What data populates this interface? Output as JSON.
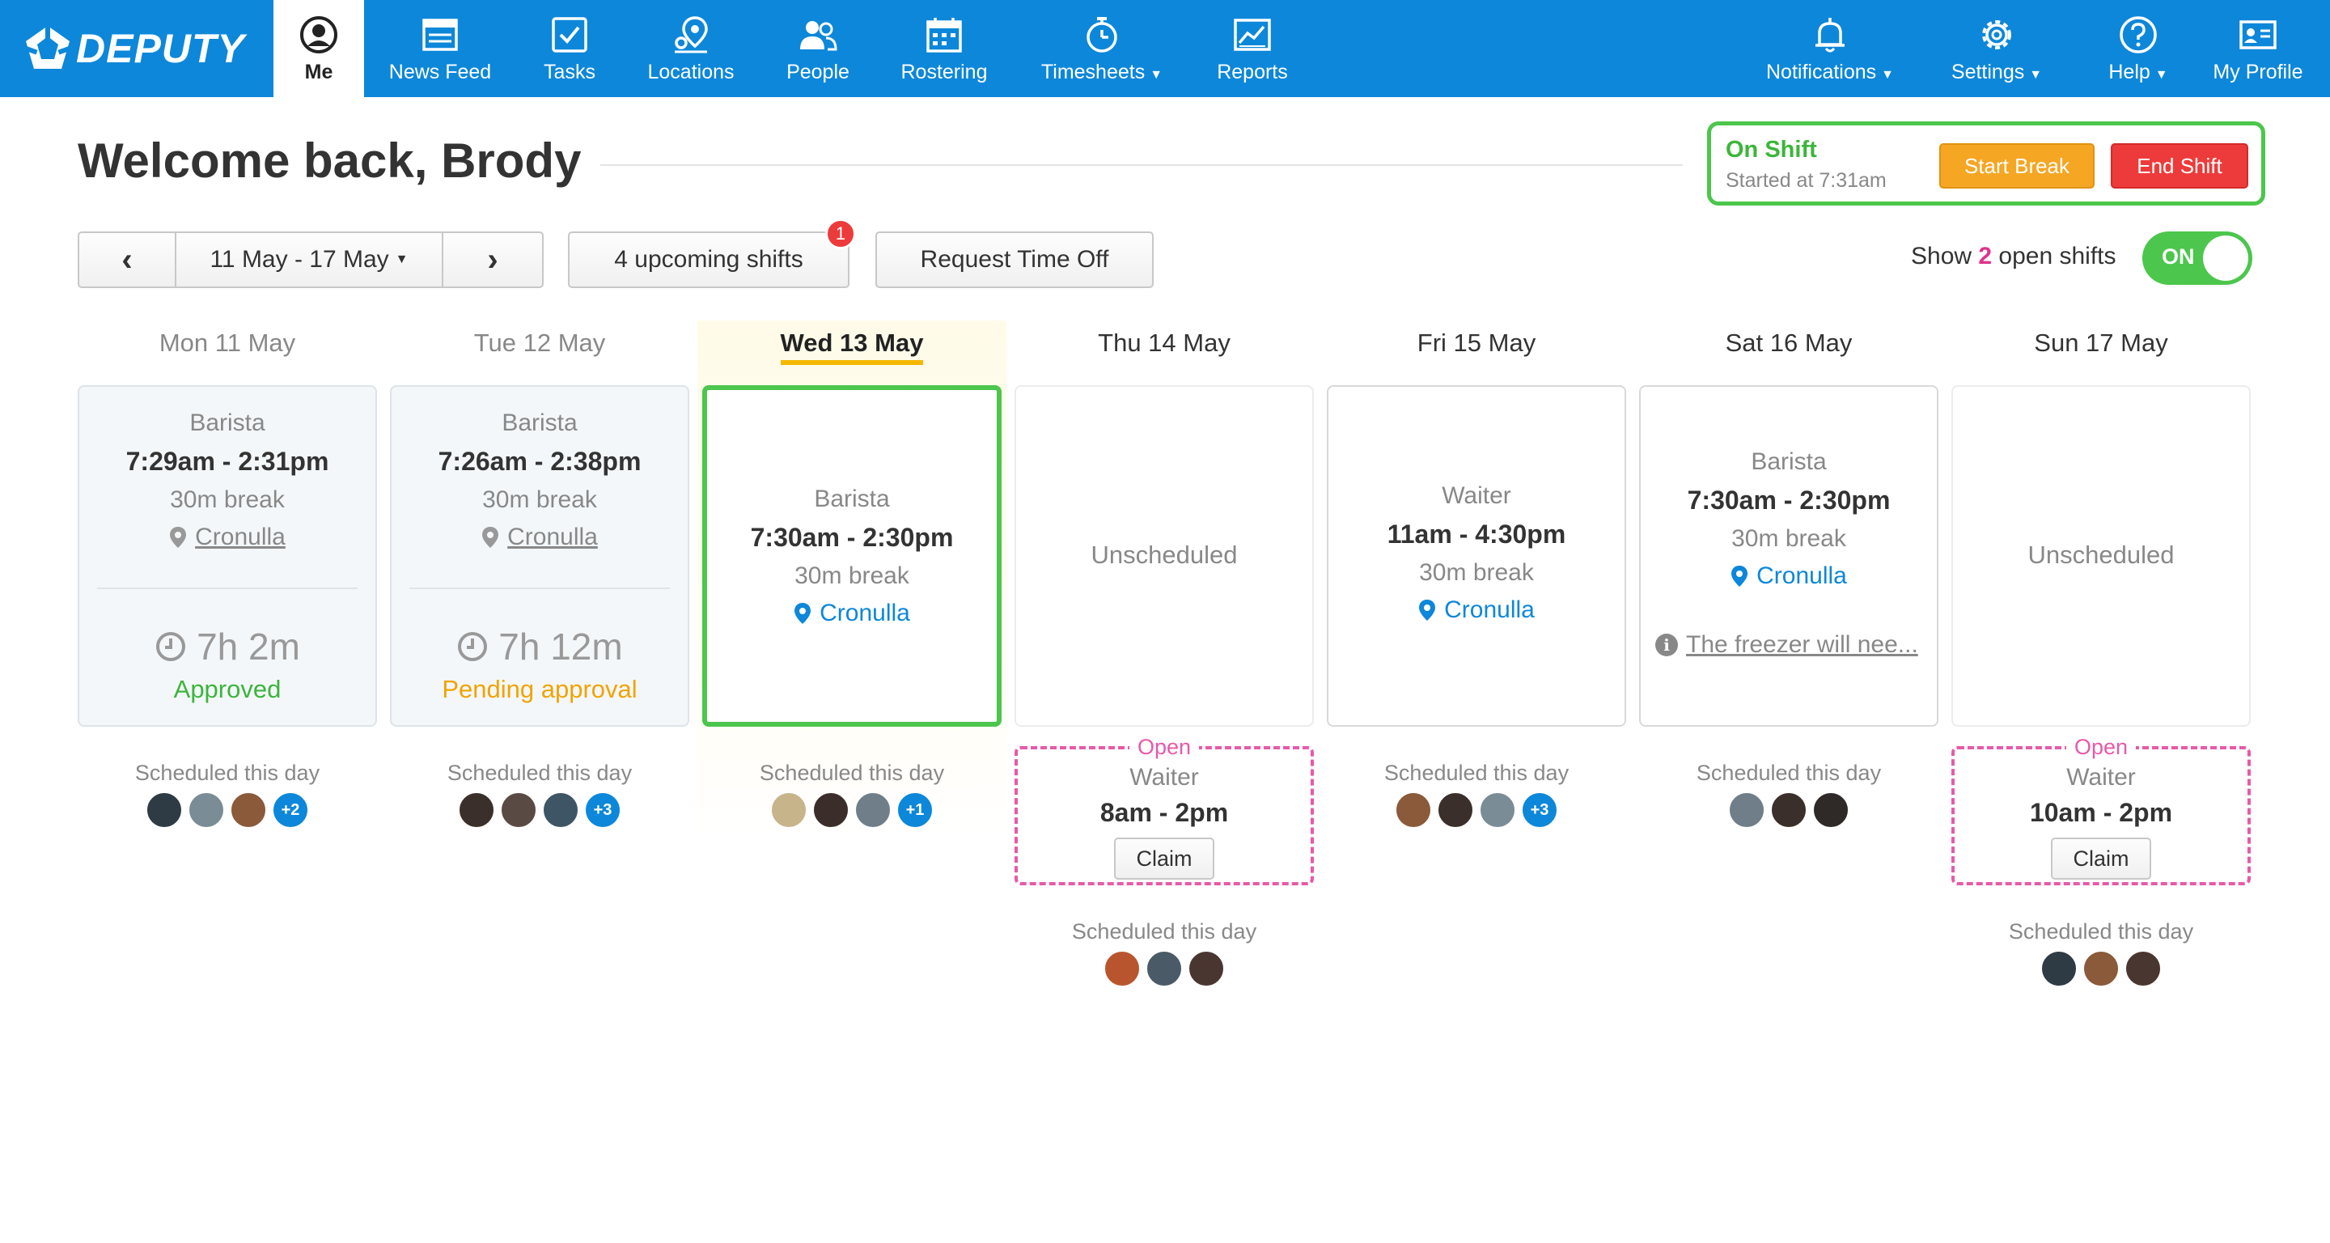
{
  "brand": {
    "name": "DEPUTY"
  },
  "colors": {
    "nav": "#0d87d9",
    "approved": "#3bb53b",
    "pending": "#f5a800",
    "open": "#e75aa7",
    "break_btn": "#f5a623",
    "end_btn": "#ed3b3b"
  },
  "nav": {
    "me": "Me",
    "news_feed": "News Feed",
    "tasks": "Tasks",
    "locations": "Locations",
    "people": "People",
    "rostering": "Rostering",
    "timesheets": "Timesheets",
    "reports": "Reports",
    "notifications": "Notifications",
    "settings": "Settings",
    "help": "Help",
    "my_profile": "My Profile"
  },
  "header": {
    "welcome": "Welcome back, Brody"
  },
  "shift_status": {
    "title": "On Shift",
    "started": "Started at 7:31am",
    "start_break": "Start Break",
    "end_shift": "End Shift"
  },
  "toolbar": {
    "date_range": "11 May - 17 May",
    "upcoming": "4 upcoming shifts",
    "upcoming_badge": "1",
    "request_time_off": "Request Time Off",
    "show_prefix": "Show",
    "open_count": "2",
    "show_suffix": "open shifts",
    "toggle_label": "ON"
  },
  "days": [
    {
      "label": "Mon 11 May",
      "role": "Barista",
      "time": "7:29am - 2:31pm",
      "break": "30m break",
      "location": "Cronulla",
      "duration": "7h 2m",
      "status": "Approved",
      "scheduled": "Scheduled this day",
      "more": "+2"
    },
    {
      "label": "Tue 12 May",
      "role": "Barista",
      "time": "7:26am - 2:38pm",
      "break": "30m break",
      "location": "Cronulla",
      "duration": "7h 12m",
      "status": "Pending approval",
      "scheduled": "Scheduled this day",
      "more": "+3"
    },
    {
      "label": "Wed 13 May",
      "role": "Barista",
      "time": "7:30am - 2:30pm",
      "break": "30m break",
      "location": "Cronulla",
      "scheduled": "Scheduled this day",
      "more": "+1"
    },
    {
      "label": "Thu 14 May",
      "empty": "Unscheduled",
      "open": {
        "tag": "Open",
        "role": "Waiter",
        "time": "8am - 2pm",
        "claim": "Claim"
      },
      "scheduled": "Scheduled this day"
    },
    {
      "label": "Fri 15 May",
      "role": "Waiter",
      "time": "11am - 4:30pm",
      "break": "30m break",
      "location": "Cronulla",
      "scheduled": "Scheduled this day",
      "more": "+3"
    },
    {
      "label": "Sat 16 May",
      "role": "Barista",
      "time": "7:30am - 2:30pm",
      "break": "30m break",
      "location": "Cronulla",
      "note": "The freezer will nee...",
      "scheduled": "Scheduled this day"
    },
    {
      "label": "Sun 17 May",
      "empty": "Unscheduled",
      "open": {
        "tag": "Open",
        "role": "Waiter",
        "time": "10am - 2pm",
        "claim": "Claim"
      },
      "scheduled": "Scheduled this day"
    }
  ]
}
